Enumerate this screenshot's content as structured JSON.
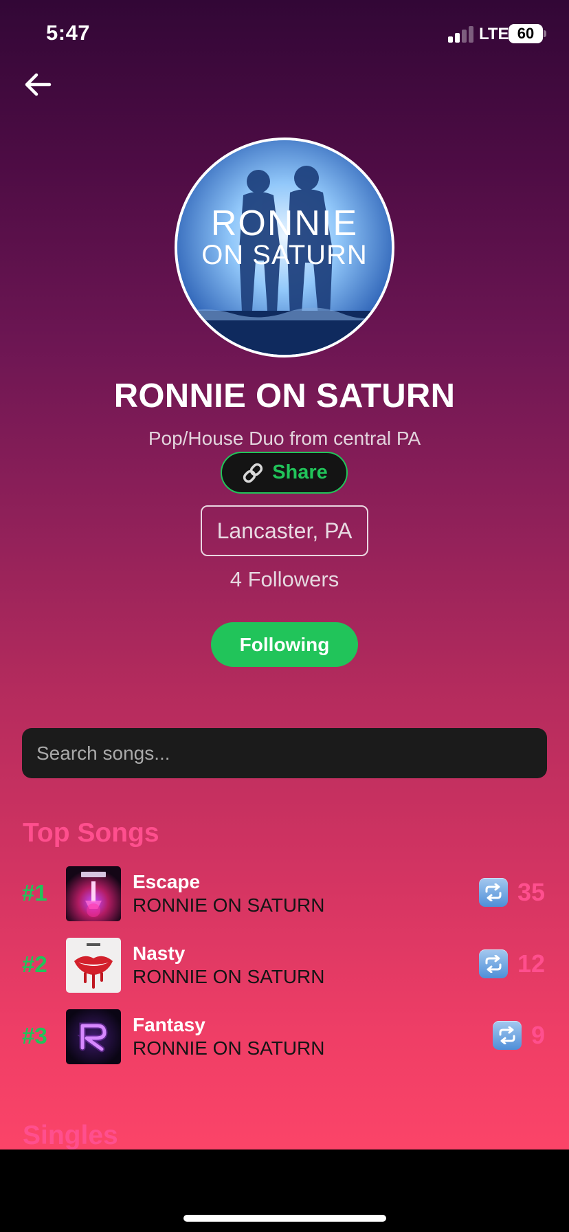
{
  "status_bar": {
    "time": "5:47",
    "network": "LTE",
    "battery": "60"
  },
  "artist": {
    "avatar_text_line1": "RONNIE",
    "avatar_text_line2": "ON SATURN",
    "name": "RONNIE ON SATURN",
    "bio": "Pop/House Duo from central PA",
    "share_label": "Share",
    "location": "Lancaster, PA",
    "followers": "4 Followers",
    "follow_button": "Following"
  },
  "search": {
    "placeholder": "Search songs..."
  },
  "top_songs": {
    "title": "Top Songs",
    "items": [
      {
        "rank": "#1",
        "title": "Escape",
        "artist": "RONNIE ON SATURN",
        "reposts": "35",
        "cover_icon": "escape-cover-art"
      },
      {
        "rank": "#2",
        "title": "Nasty",
        "artist": "RONNIE ON SATURN",
        "reposts": "12",
        "cover_icon": "nasty-cover-art"
      },
      {
        "rank": "#3",
        "title": "Fantasy",
        "artist": "RONNIE ON SATURN",
        "reposts": "9",
        "cover_icon": "fantasy-cover-art"
      }
    ]
  },
  "singles": {
    "title": "Singles"
  },
  "colors": {
    "accent_green": "#21c45a",
    "accent_pink": "#ff4f8e",
    "gradient_top": "#320736",
    "gradient_bottom": "#fb4468"
  }
}
